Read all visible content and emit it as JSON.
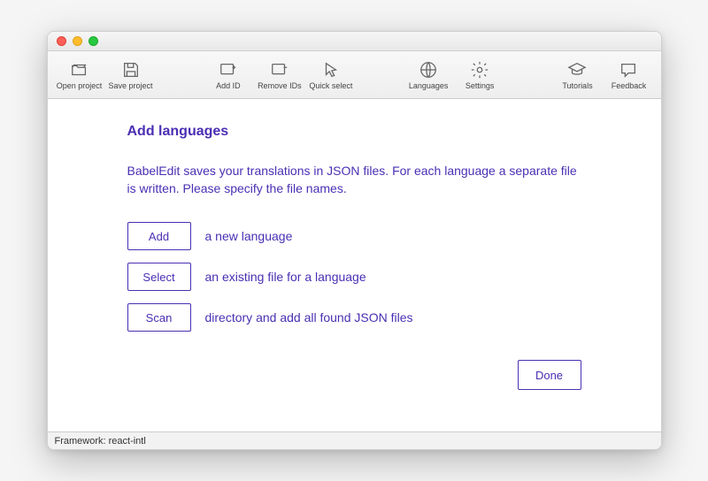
{
  "toolbar": {
    "open_project": "Open project",
    "save_project": "Save project",
    "add_id": "Add ID",
    "remove_ids": "Remove IDs",
    "quick_select": "Quick select",
    "languages": "Languages",
    "settings": "Settings",
    "tutorials": "Tutorials",
    "feedback": "Feedback"
  },
  "dialog": {
    "title": "Add languages",
    "description": "BabelEdit saves your translations in JSON files. For each language a separate file is written. Please specify the file names.",
    "add_btn": "Add",
    "add_text": "a new language",
    "select_btn": "Select",
    "select_text": "an existing file for a language",
    "scan_btn": "Scan",
    "scan_text": "directory and add all found JSON files",
    "done_btn": "Done"
  },
  "statusbar": {
    "text": "Framework: react-intl"
  }
}
